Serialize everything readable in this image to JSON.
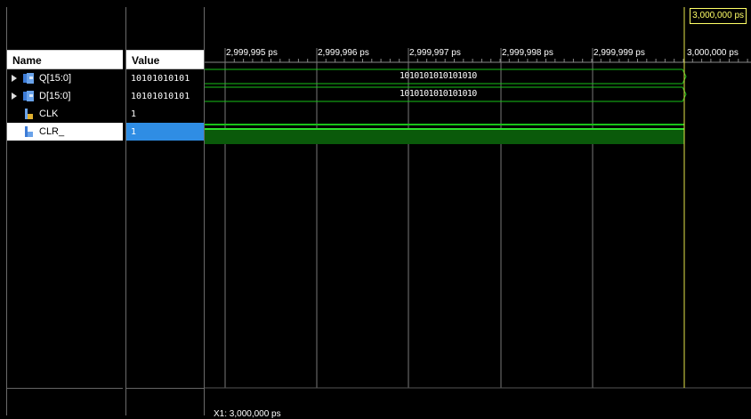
{
  "columns": {
    "name_header": "Name",
    "value_header": "Value"
  },
  "signals": [
    {
      "name": "Q[15:0]",
      "value": "10101010101",
      "expandable": true,
      "icon": "bus-icon"
    },
    {
      "name": "D[15:0]",
      "value": "10101010101",
      "expandable": true,
      "icon": "bus-icon"
    },
    {
      "name": "CLK",
      "value": "1",
      "expandable": false,
      "icon": "bit-icon"
    },
    {
      "name": "CLR_",
      "value": "1",
      "expandable": false,
      "icon": "bit-icon",
      "selected": true
    }
  ],
  "timeline": {
    "ticks": [
      "2,999,995 ps",
      "2,999,996 ps",
      "2,999,997 ps",
      "2,999,998 ps",
      "2,999,999 ps",
      "3,000,000 ps"
    ],
    "cursor_label": "3,000,000 ps",
    "x1_label": "X1: 3,000,000 ps"
  },
  "bus_values": {
    "q": "1010101010101010",
    "d": "1010101010101010"
  },
  "colors": {
    "waveform": "#19c219",
    "waveform_fill": "#0a5a0a",
    "cursor": "#ffff66",
    "selection": "#2f8de4"
  }
}
